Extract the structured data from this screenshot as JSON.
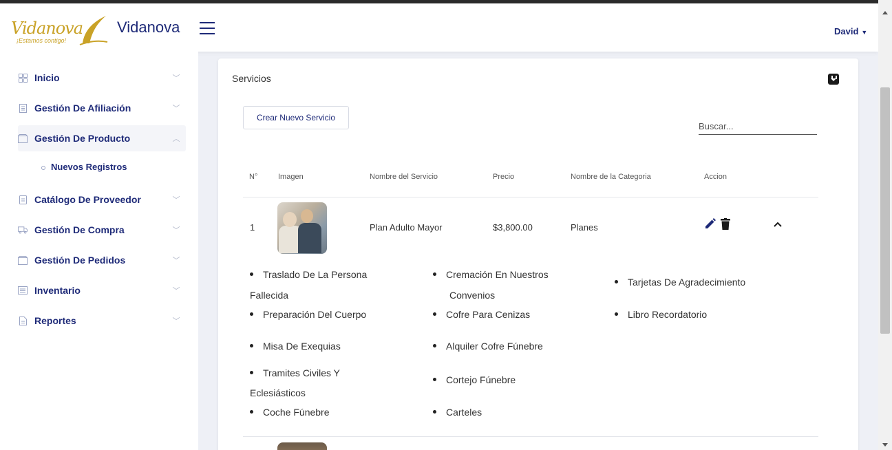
{
  "header": {
    "logo_script": "Vidanova",
    "logo_tagline": "¡Estamos contigo!",
    "brand": "Vidanova",
    "user_name": "David"
  },
  "sidebar": {
    "items": [
      {
        "label": "Inicio",
        "icon": "grid-icon",
        "expanded": false
      },
      {
        "label": "Gestión De Afiliación",
        "icon": "document-list-icon",
        "expanded": false
      },
      {
        "label": "Gestión De Producto",
        "icon": "box-icon",
        "expanded": true
      },
      {
        "label": "Catálogo De Proveedor",
        "icon": "document-icon",
        "expanded": false
      },
      {
        "label": "Gestión De Compra",
        "icon": "truck-icon",
        "expanded": false
      },
      {
        "label": "Gestión De Pedidos",
        "icon": "box-icon",
        "expanded": false
      },
      {
        "label": "Inventario",
        "icon": "list-icon",
        "expanded": false
      },
      {
        "label": "Reportes",
        "icon": "file-icon",
        "expanded": false
      }
    ],
    "sub_item": "Nuevos Registros"
  },
  "main": {
    "title": "Servicios",
    "create_button": "Crear Nuevo Servicio",
    "search_placeholder": "Buscar...",
    "columns": [
      "N°",
      "Imagen",
      "Nombre del Servicio",
      "Precio",
      "Nombre de la Categoria",
      "Accion"
    ],
    "rows": [
      {
        "number": "1",
        "name": "Plan Adulto Mayor",
        "price": "$3,800.00",
        "category": "Planes",
        "features": {
          "col1": [
            "Traslado De La Persona",
            "Fallecida",
            "Preparación Del Cuerpo",
            "Misa De Exequias",
            "Tramites Civiles Y",
            "Eclesiásticos",
            "Coche Fúnebre"
          ],
          "col2": [
            "Cremación En Nuestros",
            "Convenios",
            "Cofre Para Cenizas",
            "Alquiler Cofre Fúnebre",
            "Cortejo Fúnebre",
            "Carteles"
          ],
          "col3": [
            "Tarjetas De Agradecimiento",
            "Libro Recordatorio"
          ]
        }
      }
    ]
  },
  "colors": {
    "primary": "#1e2a78",
    "gold": "#c9a227",
    "background": "#eef0f6"
  }
}
